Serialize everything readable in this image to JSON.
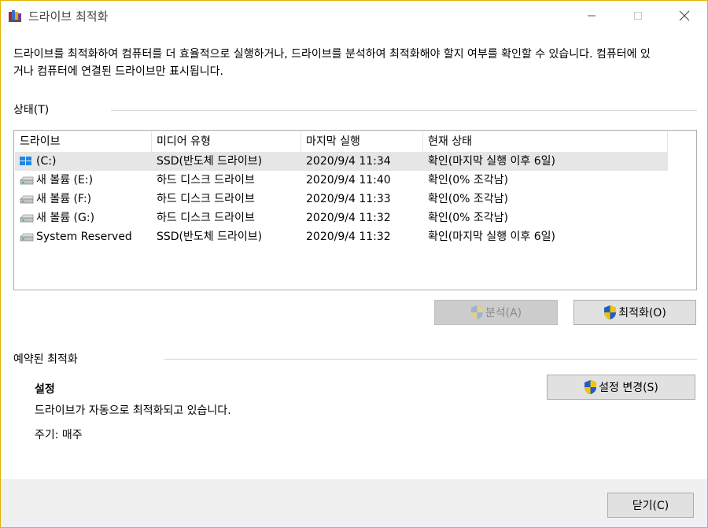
{
  "window": {
    "title": "드라이브 최적화",
    "minimize_icon": "minimize-icon",
    "maximize_icon": "maximize-icon",
    "close_icon": "close-icon"
  },
  "description": "드라이브를 최적화하여 컴퓨터를 더 효율적으로 실행하거나, 드라이브를 분석하여 최적화해야 할지 여부를 확인할 수 있습니다. 컴퓨터에 있거나 컴퓨터에 연결된 드라이브만 표시됩니다.",
  "status": {
    "label": "상태(T)",
    "columns": [
      "드라이브",
      "미디어 유형",
      "마지막 실행",
      "현재 상태"
    ],
    "rows": [
      {
        "drive": "(C:)",
        "media": "SSD(반도체 드라이브)",
        "last_run": "2020/9/4 11:34",
        "state": "확인(마지막 실행 이후 6일)",
        "icon": "windows-drive-icon"
      },
      {
        "drive": "새 볼륨 (E:)",
        "media": "하드 디스크 드라이브",
        "last_run": "2020/9/4 11:40",
        "state": "확인(0% 조각남)",
        "icon": "hard-drive-icon"
      },
      {
        "drive": "새 볼륨 (F:)",
        "media": "하드 디스크 드라이브",
        "last_run": "2020/9/4 11:33",
        "state": "확인(0% 조각남)",
        "icon": "hard-drive-icon"
      },
      {
        "drive": "새 볼륨 (G:)",
        "media": "하드 디스크 드라이브",
        "last_run": "2020/9/4 11:32",
        "state": "확인(0% 조각남)",
        "icon": "hard-drive-icon"
      },
      {
        "drive": "System Reserved",
        "media": "SSD(반도체 드라이브)",
        "last_run": "2020/9/4 11:32",
        "state": "확인(마지막 실행 이후 6일)",
        "icon": "hard-drive-icon"
      }
    ]
  },
  "buttons": {
    "analyze": "분석(A)",
    "optimize": "최적화(O)",
    "change_settings": "설정 변경(S)",
    "close": "닫기(C)"
  },
  "scheduled": {
    "label": "예약된 최적화",
    "settings_title": "설정",
    "settings_text": "드라이브가 자동으로 최적화되고 있습니다.",
    "period": "주기: 매주"
  },
  "colors": {
    "accent_border": "#e0b400",
    "selection": "#e5f3ff",
    "shield_blue": "#1f5ec9",
    "shield_yellow": "#f2c300"
  }
}
